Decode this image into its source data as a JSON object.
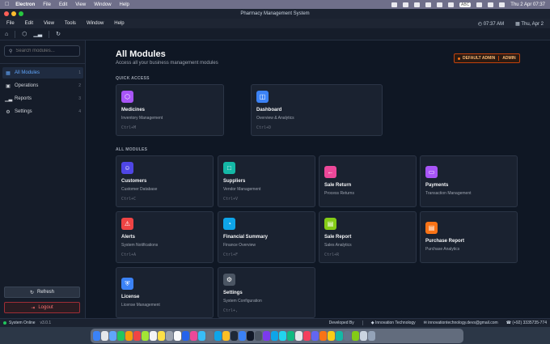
{
  "macos_menubar": {
    "app_name": "Electron",
    "items": [
      "File",
      "Edit",
      "View",
      "Window",
      "Help"
    ],
    "status_text": "ABC",
    "datetime": "Thu 2 Apr  07:37"
  },
  "window": {
    "title": "Pharmacy Management System"
  },
  "app_menu": {
    "items": [
      "File",
      "Edit",
      "View",
      "Tools",
      "Window",
      "Help"
    ],
    "time": "07:37 AM",
    "date": "Thu, Apr 2"
  },
  "sidebar": {
    "search_placeholder": "Search modules...",
    "items": [
      {
        "label": "All Modules",
        "num": "1",
        "icon": "grid-icon"
      },
      {
        "label": "Operations",
        "num": "2",
        "icon": "operations-icon"
      },
      {
        "label": "Reports",
        "num": "3",
        "icon": "chart-icon"
      },
      {
        "label": "Settings",
        "num": "4",
        "icon": "gear-icon"
      }
    ],
    "refresh_label": "Refresh",
    "logout_label": "Logout"
  },
  "main": {
    "title": "All Modules",
    "subtitle": "Access all your business management modules",
    "role": {
      "branch": "DEFAULT ADMIN",
      "user": "ADMIN"
    },
    "quick_access_label": "QUICK ACCESS",
    "all_modules_label": "ALL MODULES",
    "quick_access": [
      {
        "title": "Medicines",
        "subtitle": "Inventory Management",
        "shortcut": "Ctrl+M",
        "color": "#a855f7",
        "icon": "box-icon"
      },
      {
        "title": "Dashboard",
        "subtitle": "Overview & Analytics",
        "shortcut": "Ctrl+D",
        "color": "#3b82f6",
        "icon": "database-icon"
      }
    ],
    "modules": [
      {
        "title": "Customers",
        "subtitle": "Customer Database",
        "shortcut": "Ctrl+C",
        "color": "#4f46e5",
        "icon": "users-icon"
      },
      {
        "title": "Suppliers",
        "subtitle": "Vendor Management",
        "shortcut": "Ctrl+V",
        "color": "#14b8a6",
        "icon": "briefcase-icon"
      },
      {
        "title": "Sale Return",
        "subtitle": "Process Returns",
        "shortcut": "",
        "color": "#ec4899",
        "icon": "arrow-left-icon"
      },
      {
        "title": "Payments",
        "subtitle": "Transaction Management",
        "shortcut": "",
        "color": "#a855f7",
        "icon": "card-icon"
      },
      {
        "title": "Alerts",
        "subtitle": "System Notifications",
        "shortcut": "Ctrl+A",
        "color": "#ef4444",
        "icon": "warning-icon"
      },
      {
        "title": "Financial Summary",
        "subtitle": "Finance Overview",
        "shortcut": "Ctrl+F",
        "color": "#0ea5e9",
        "icon": "pie-icon"
      },
      {
        "title": "Sale Report",
        "subtitle": "Sales Analytics",
        "shortcut": "Ctrl+R",
        "color": "#84cc16",
        "icon": "report-icon"
      },
      {
        "title": "Purchase Report",
        "subtitle": "Purchase Analytics",
        "shortcut": "",
        "color": "#f97316",
        "icon": "document-icon"
      },
      {
        "title": "License",
        "subtitle": "License Management",
        "shortcut": "",
        "color": "#3b82f6",
        "icon": "shield-icon"
      },
      {
        "title": "Settings",
        "subtitle": "System Configuration",
        "shortcut": "Ctrl+,",
        "color": "#4b5563",
        "icon": "gear-icon"
      }
    ]
  },
  "statusbar": {
    "status": "System Online",
    "version": "v3.0.1",
    "developed_by": "Developed By",
    "company": "Innovation Technology",
    "email": "innovationtechnology.devs@gmail.com",
    "phone": "(+92) 3335735-774"
  }
}
